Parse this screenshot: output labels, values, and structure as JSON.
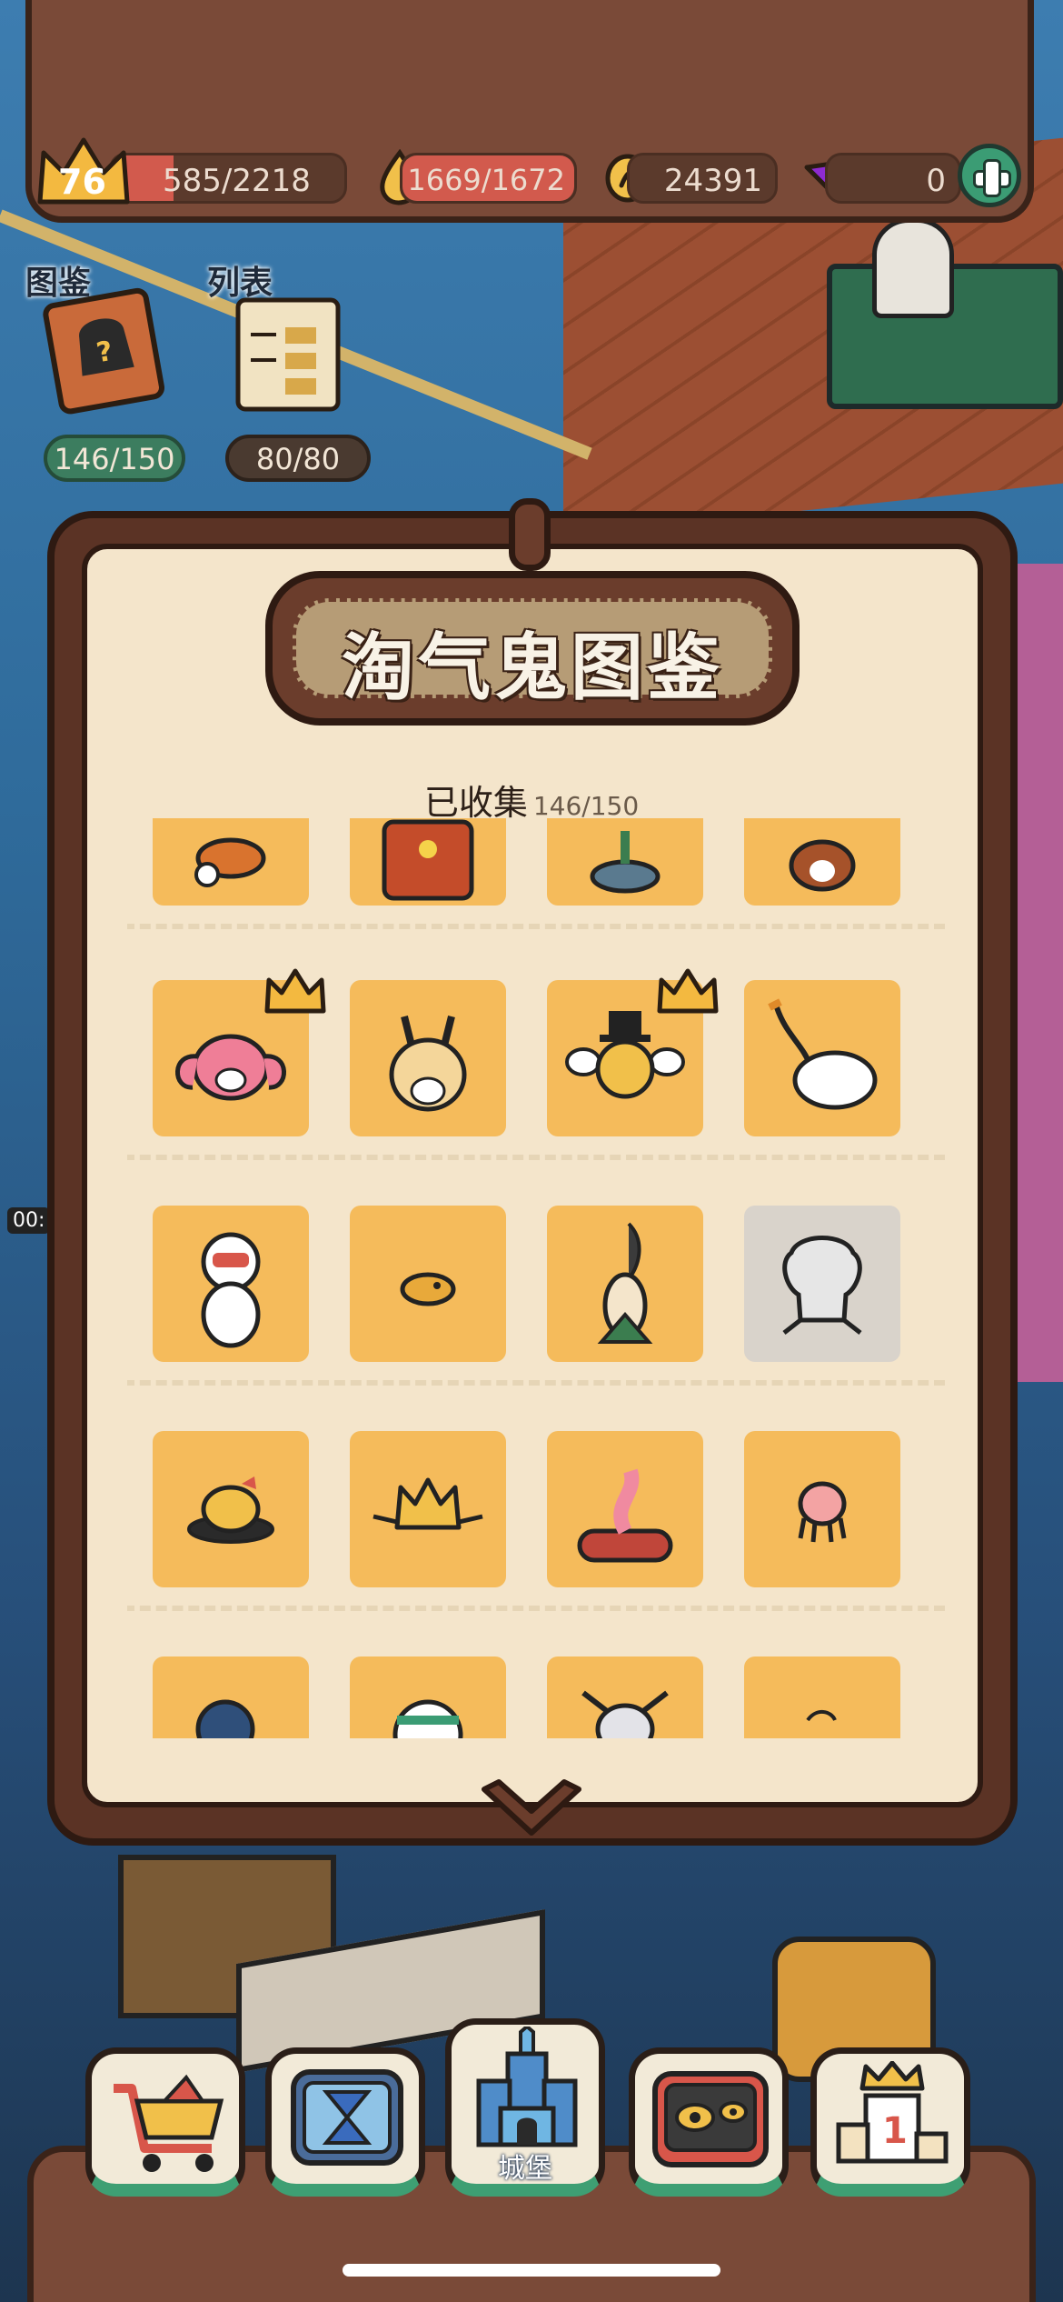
{
  "hud": {
    "level": "76",
    "exp": "585/2218",
    "energy": "1669/1672",
    "coins": "24391",
    "gems": "0",
    "level_progress": 0.26,
    "energy_progress": 0.998
  },
  "side": {
    "codex_label": "图鉴",
    "list_label": "列表",
    "codex_count": "146/150",
    "list_count": "80/80"
  },
  "panel": {
    "title": "淘气鬼图鉴",
    "collected_label": "已收集",
    "collected_count": "146/150"
  },
  "nav": {
    "castle_label": "城堡",
    "items": [
      "shop-icon",
      "hourglass-tv-icon",
      "castle-icon",
      "monster-tv-icon",
      "ranking-trophy-icon"
    ]
  },
  "edge_timer": "00:",
  "colors": {
    "card": "#f5bb5b",
    "card_locked": "#d9d3cb",
    "panel_bg": "#f4e5cb",
    "frame": "#5b3325",
    "accent_green": "#3b9c74",
    "bar_red": "#d25a4d"
  }
}
